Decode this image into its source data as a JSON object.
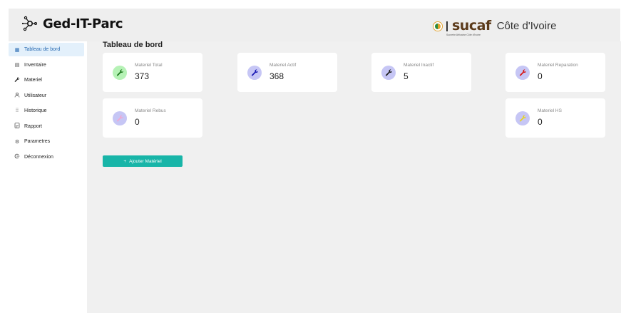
{
  "header": {
    "app_title": "Ged-IT-Parc",
    "brand_name": "sucaf",
    "brand_region": "Côte d'Ivoire",
    "brand_subtitle": "Sucrerie Africaine Côte d'Ivoire"
  },
  "sidebar": {
    "items": [
      {
        "label": "Tableau de bord",
        "icon": "grid-icon",
        "active": true
      },
      {
        "label": "Inventaire",
        "icon": "inventory-icon"
      },
      {
        "label": "Materiel",
        "icon": "wrench-icon"
      },
      {
        "label": "Utilisateur",
        "icon": "user-icon"
      },
      {
        "label": "Historique",
        "icon": "history-icon"
      },
      {
        "label": "Rapport",
        "icon": "report-icon"
      },
      {
        "label": "Parametres",
        "icon": "settings-icon"
      },
      {
        "label": "Déconnexion",
        "icon": "logout-icon"
      }
    ]
  },
  "main": {
    "title": "Tableau de bord",
    "cards": [
      {
        "label": "Materiel Total",
        "value": "373",
        "icon_bg": "#b6f2b6",
        "icon_color": "#1f7a1f"
      },
      {
        "label": "Materiel Actif",
        "value": "368",
        "icon_bg": "#c6c6f5",
        "icon_color": "#1a1ab5"
      },
      {
        "label": "Materiel Inactif",
        "value": "5",
        "icon_bg": "#c6c6f5",
        "icon_color": "#222222"
      },
      {
        "label": "Materiel Reparation",
        "value": "0",
        "icon_bg": "#c6c6f5",
        "icon_color": "#d61a1a"
      },
      {
        "label": "Materiel Rebus",
        "value": "0",
        "icon_bg": "#c6c6f5",
        "icon_color": "#f0a8d0"
      },
      {
        "label": "Materiel HS",
        "value": "0",
        "icon_bg": "#c6c6f5",
        "icon_color": "#e6d422"
      }
    ],
    "add_button": {
      "icon": "+",
      "label": "Ajouter Matériel"
    }
  }
}
